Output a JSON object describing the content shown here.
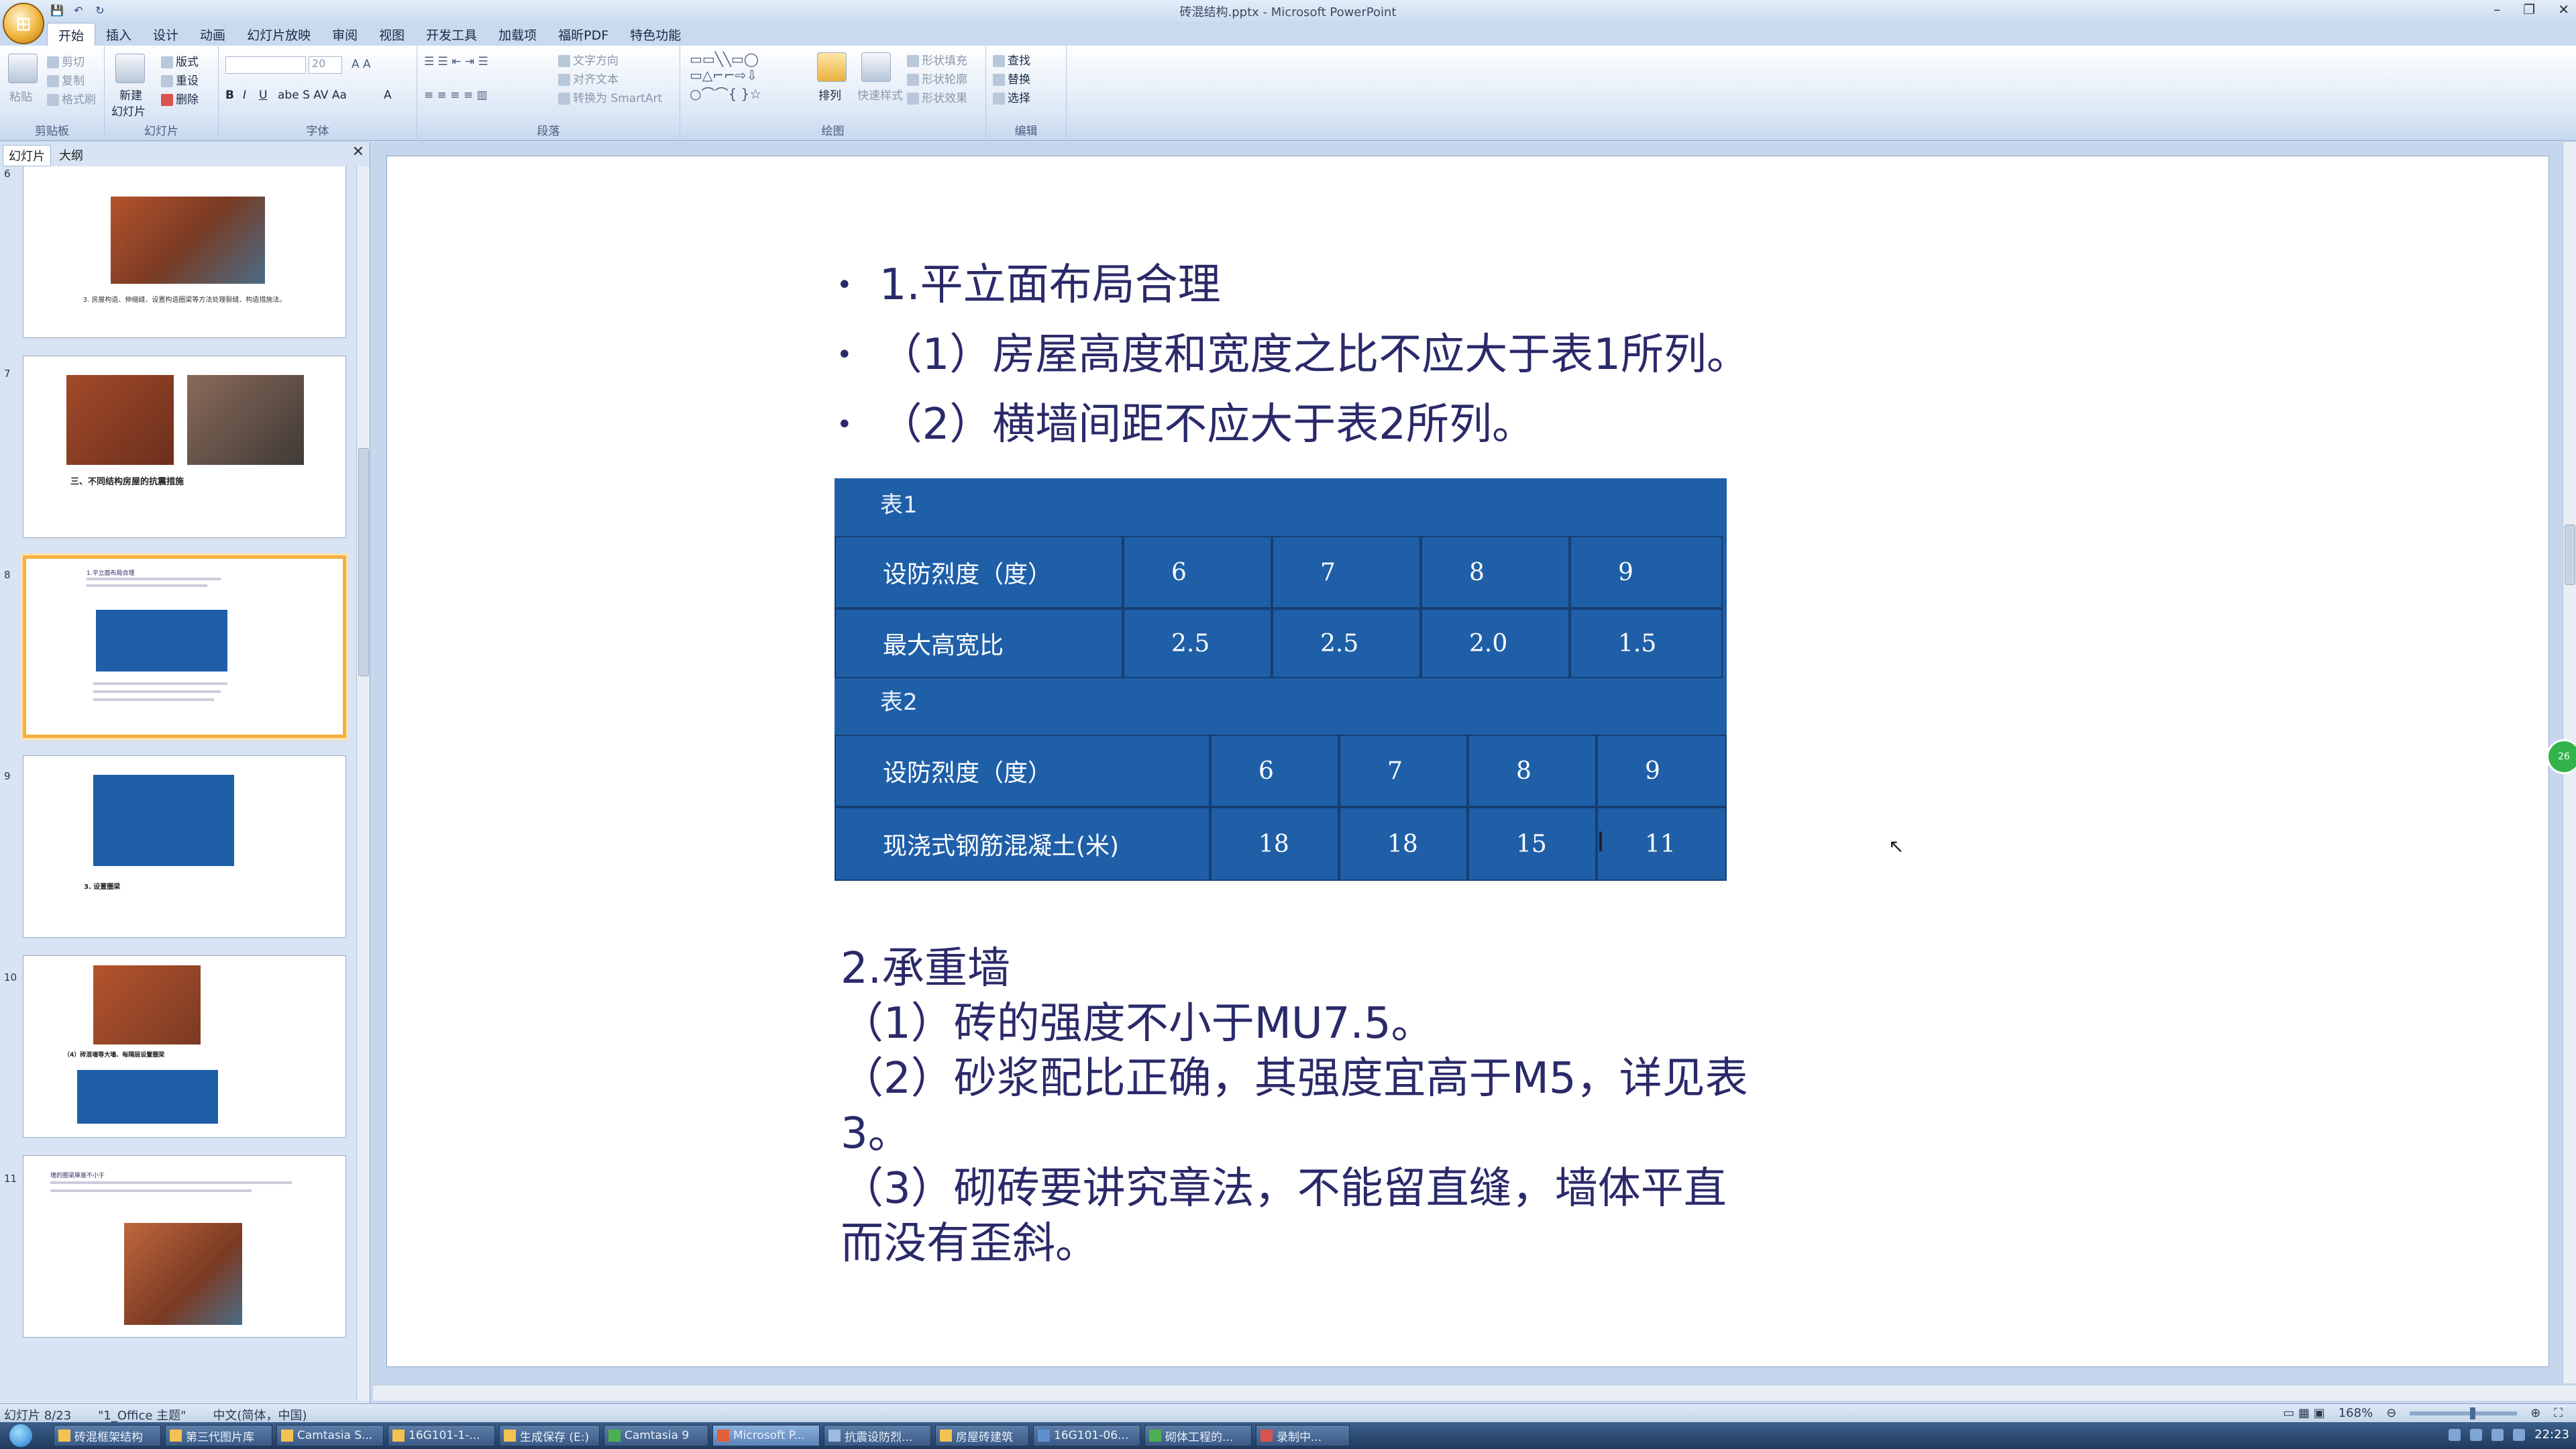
{
  "window": {
    "title": "砖混结构.pptx - Microsoft PowerPoint",
    "controls": [
      "–",
      "❐",
      "✕"
    ]
  },
  "ribbon_tabs": [
    "开始",
    "插入",
    "设计",
    "动画",
    "幻灯片放映",
    "审阅",
    "视图",
    "开发工具",
    "加载项",
    "福昕PDF",
    "特色功能"
  ],
  "ribbon": {
    "clipboard": {
      "label": "剪贴板",
      "paste": "粘贴",
      "cut": "剪切",
      "copy": "复制",
      "format": "格式刷"
    },
    "slides": {
      "label": "幻灯片",
      "new": "新建",
      "new2": "幻灯片",
      "layout": "版式",
      "reset": "重设",
      "delete": "删除"
    },
    "font": {
      "label": "字体",
      "size": "20"
    },
    "paragraph": {
      "label": "段落",
      "text_dir": "文字方向",
      "align_text": "对齐文本",
      "smartart": "转换为 SmartArt"
    },
    "drawing": {
      "label": "绘图",
      "arrange": "排列",
      "quick_styles": "快速样式",
      "fill": "形状填充",
      "outline": "形状轮廓",
      "effects": "形状效果"
    },
    "editing": {
      "label": "编辑",
      "find": "查找",
      "replace": "替换",
      "select": "选择"
    }
  },
  "left_panel": {
    "tab_slides": "幻灯片",
    "tab_outline": "大纲",
    "close": "✕",
    "thumbnails": [
      {
        "num": "6",
        "caption": "3. 房屋构造、伸缩缝、设置构造圈梁等方法处理裂缝、构造措施法。"
      },
      {
        "num": "7",
        "caption": "三、不同结构房屋的抗震措施"
      },
      {
        "num": "8",
        "caption": "1.平立面布局合理",
        "selected": true
      },
      {
        "num": "9",
        "caption": "3. 设置圈梁"
      },
      {
        "num": "10",
        "caption": "（4）砖混墙等大墙、每隔层设置圈梁"
      },
      {
        "num": "11",
        "caption": "墙的圈梁厚度不小于"
      }
    ]
  },
  "slide": {
    "bullets": [
      "1.平立面布局合理",
      "（1）房屋高度和宽度之比不应大于表1所列。",
      "（2）横墙间距不应大于表2所列。"
    ],
    "table1": {
      "caption": "表1",
      "row1": [
        "设防烈度（度）",
        "6",
        "7",
        "8",
        "9"
      ],
      "row2": [
        "最大高宽比",
        "2.5",
        "2.5",
        "2.0",
        "1.5"
      ]
    },
    "table2": {
      "caption": "表2",
      "row1": [
        "设防烈度（度）",
        "6",
        "7",
        "8",
        "9"
      ],
      "row2": [
        "现浇式钢筋混凝土(米)",
        "18",
        "18",
        "15",
        "11"
      ]
    },
    "body": [
      "2.承重墙",
      "（1）砖的强度不小于MU7.5。",
      "（2）砂浆配比正确，其强度宜高于M5，详见表3。",
      "（3）砌砖要讲究章法，不能留直缝，墙体平直而没有歪斜。"
    ]
  },
  "statusbar": {
    "slide_count": "幻灯片 8/23",
    "theme": "\"1_Office 主题\"",
    "language": "中文(简体，中国)",
    "zoom": "168%"
  },
  "taskbar": {
    "items": [
      "砖混框架结构",
      "第三代图片库",
      "Camtasia S...",
      "16G101-1-...",
      "生成保存 (E:)",
      "Camtasia 9",
      "Microsoft P...",
      "抗震设防烈...",
      "房屋砖建筑",
      "16G101-06...",
      "砌体工程的...",
      "录制中..."
    ],
    "clock": "22:23"
  },
  "colors": {
    "table_bg": "#1f5fa8",
    "slide_text": "#2a2a6a",
    "selected_thumb": "#f5b040"
  }
}
